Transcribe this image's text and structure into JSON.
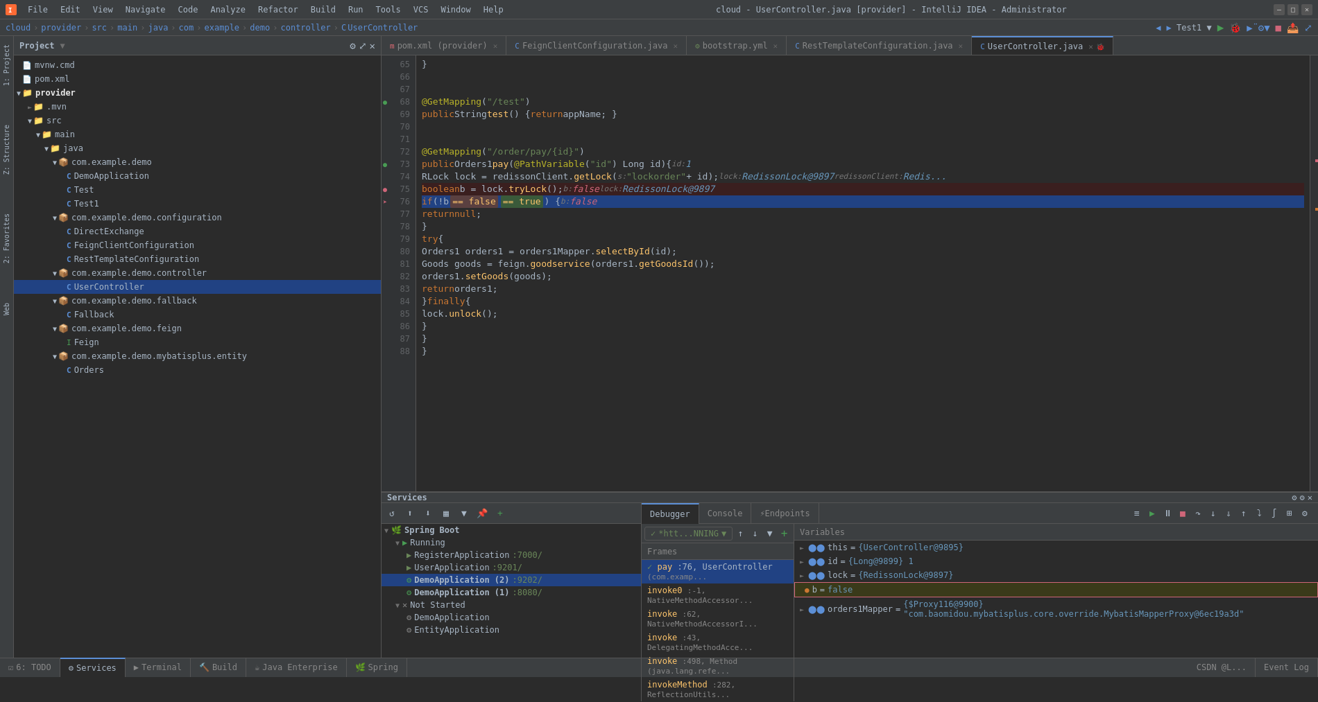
{
  "window": {
    "title": "cloud - UserController.java [provider] - IntelliJ IDEA - Administrator"
  },
  "menubar": {
    "items": [
      "File",
      "Edit",
      "View",
      "Navigate",
      "Code",
      "Analyze",
      "Refactor",
      "Build",
      "Run",
      "Tools",
      "VCS",
      "Window",
      "Help"
    ]
  },
  "breadcrumb": {
    "parts": [
      "cloud",
      "provider",
      "src",
      "main",
      "java",
      "com",
      "example",
      "demo",
      "controller",
      "UserController"
    ]
  },
  "run_config": {
    "name": "Test1"
  },
  "project_panel": {
    "title": "Project",
    "tree": [
      {
        "indent": 0,
        "type": "file",
        "icon": "mvn",
        "label": "mvnw.cmd",
        "level": 0
      },
      {
        "indent": 0,
        "type": "xml",
        "icon": "xml",
        "label": "pom.xml",
        "level": 0
      },
      {
        "indent": 0,
        "type": "folder",
        "label": "provider",
        "bold": true,
        "expanded": true,
        "level": 0
      },
      {
        "indent": 1,
        "type": "folder",
        "label": ".mvn",
        "expanded": false,
        "level": 1
      },
      {
        "indent": 1,
        "type": "folder",
        "label": "src",
        "expanded": true,
        "level": 1
      },
      {
        "indent": 2,
        "type": "folder",
        "label": "main",
        "expanded": true,
        "level": 2
      },
      {
        "indent": 3,
        "type": "folder",
        "label": "java",
        "expanded": true,
        "level": 3
      },
      {
        "indent": 4,
        "type": "folder",
        "label": "com.example.demo",
        "expanded": true,
        "level": 4
      },
      {
        "indent": 5,
        "type": "class",
        "icon": "C",
        "label": "DemoApplication",
        "level": 5
      },
      {
        "indent": 5,
        "type": "class",
        "icon": "C",
        "label": "Test",
        "level": 5
      },
      {
        "indent": 5,
        "type": "class",
        "icon": "C",
        "label": "Test1",
        "level": 5
      },
      {
        "indent": 4,
        "type": "folder",
        "label": "com.example.demo.configuration",
        "expanded": true,
        "level": 4
      },
      {
        "indent": 5,
        "type": "class",
        "icon": "C",
        "label": "DirectExchange",
        "level": 5
      },
      {
        "indent": 5,
        "type": "class",
        "icon": "C",
        "label": "FeignClientConfiguration",
        "level": 5
      },
      {
        "indent": 5,
        "type": "class",
        "icon": "C",
        "label": "RestTemplateConfiguration",
        "level": 5
      },
      {
        "indent": 4,
        "type": "folder",
        "label": "com.example.demo.controller",
        "expanded": true,
        "level": 4
      },
      {
        "indent": 5,
        "type": "class",
        "icon": "C",
        "label": "UserController",
        "selected": true,
        "level": 5
      },
      {
        "indent": 4,
        "type": "folder",
        "label": "com.example.demo.fallback",
        "expanded": true,
        "level": 4
      },
      {
        "indent": 5,
        "type": "class",
        "icon": "C",
        "label": "Fallback",
        "level": 5
      },
      {
        "indent": 4,
        "type": "folder",
        "label": "com.example.demo.feign",
        "expanded": true,
        "level": 4
      },
      {
        "indent": 5,
        "type": "interface",
        "icon": "I",
        "label": "Feign",
        "level": 5
      },
      {
        "indent": 4,
        "type": "folder",
        "label": "com.example.demo.mybatisplus.entity",
        "expanded": true,
        "level": 4
      },
      {
        "indent": 5,
        "type": "class",
        "icon": "C",
        "label": "Orders",
        "level": 5
      }
    ]
  },
  "tabs": [
    {
      "id": "pom",
      "label": "pom.xml (provider)",
      "icon": "xml",
      "active": false
    },
    {
      "id": "feign",
      "label": "FeignClientConfiguration.java",
      "icon": "C",
      "active": false
    },
    {
      "id": "bootstrap",
      "label": "bootstrap.yml",
      "icon": "yml",
      "active": false
    },
    {
      "id": "rest",
      "label": "RestTemplateConfiguration.java",
      "icon": "C",
      "active": false
    },
    {
      "id": "user",
      "label": "UserController.java",
      "icon": "C",
      "active": true
    }
  ],
  "code": {
    "lines": [
      {
        "num": 65,
        "content": "    }"
      },
      {
        "num": 66,
        "content": ""
      },
      {
        "num": 67,
        "content": ""
      },
      {
        "num": 68,
        "content": "    @GetMapping(\"/test\")",
        "type": "annotation_line",
        "gutter": "green"
      },
      {
        "num": 69,
        "content": "    public String test() { return appName; }"
      },
      {
        "num": 70,
        "content": ""
      },
      {
        "num": 71,
        "content": ""
      },
      {
        "num": 72,
        "content": "    @GetMapping(\"/order/pay/{id}\")"
      },
      {
        "num": 73,
        "content": "    public Orders1 pay(@PathVariable(\"id\") Long id){  id: 1",
        "type": "annotation_line",
        "gutter": "green"
      },
      {
        "num": 74,
        "content": "        RLock lock = redissonClient.getLock(s: \"lockorder\" + id);  lock: RedissonLock@9897  redissonClient: Redis..."
      },
      {
        "num": 75,
        "content": "        boolean b = lock.tryLock();  b: false  lock: RedissonLock@9897",
        "gutter": "breakpoint"
      },
      {
        "num": 76,
        "content": "        if(!b  == false  == true  ) {  b: false",
        "highlighted": true
      },
      {
        "num": 77,
        "content": "            return null;"
      },
      {
        "num": 78,
        "content": "        }"
      },
      {
        "num": 79,
        "content": "        try {"
      },
      {
        "num": 80,
        "content": "            Orders1 orders1 = orders1Mapper.selectById(id);"
      },
      {
        "num": 81,
        "content": "            Goods goods = feign.goodservice(orders1.getGoodsId());"
      },
      {
        "num": 82,
        "content": "            orders1.setGoods(goods);"
      },
      {
        "num": 83,
        "content": "            return orders1;"
      },
      {
        "num": 84,
        "content": "        }finally {"
      },
      {
        "num": 85,
        "content": "            lock.unlock();"
      },
      {
        "num": 86,
        "content": "        }"
      },
      {
        "num": 87,
        "content": "    }"
      },
      {
        "num": 88,
        "content": "}"
      }
    ]
  },
  "bottom_panel": {
    "title": "Services"
  },
  "debugger_tabs": [
    {
      "label": "Debugger",
      "active": true
    },
    {
      "label": "Console",
      "active": false
    },
    {
      "label": "Endpoints",
      "active": false
    }
  ],
  "thread_selector": {
    "label": "*htt...NNING"
  },
  "frames": {
    "header": "Frames",
    "items": [
      {
        "selected": true,
        "method": "pay",
        "line": 76,
        "class": "UserController",
        "extra": "(com.examp..."
      },
      {
        "method": "invoke0",
        "line": -1,
        "extra": "NativeMethodAccessor..."
      },
      {
        "method": "invoke",
        "line": 62,
        "extra": "NativeMethodAccessorI..."
      },
      {
        "method": "invoke",
        "line": 43,
        "extra": "DelegatingMethodAcce..."
      },
      {
        "method": "invoke",
        "line": 498,
        "extra": "Method (java.lang.refl..."
      },
      {
        "method": "invokeMethod",
        "line": 282,
        "extra": "ReflectionUtils..."
      }
    ]
  },
  "variables": {
    "header": "Variables",
    "items": [
      {
        "icon": "►",
        "name": "this",
        "eq": "=",
        "value": "{UserController@9895}"
      },
      {
        "icon": "►",
        "name": "id",
        "eq": "=",
        "value": "{Long@9899} 1"
      },
      {
        "icon": "►",
        "name": "lock",
        "eq": "=",
        "value": "{RedissonLock@9897}"
      },
      {
        "icon": "●",
        "name": "b",
        "eq": "=",
        "value": "false",
        "highlighted": true
      },
      {
        "icon": "►",
        "name": "orders1Mapper",
        "eq": "=",
        "value": "{$Proxy116@9900} \"com.baomidou.mybatisplus.core.override.MybatisMapperProxy@6ec19a3d\""
      }
    ]
  },
  "services": {
    "label": "Services",
    "spring_boot": {
      "label": "Spring Boot",
      "running": {
        "label": "Running",
        "items": [
          {
            "name": "RegisterApplication",
            "port": ":7000/",
            "status": "running"
          },
          {
            "name": "UserApplication",
            "port": ":9201/",
            "status": "running"
          },
          {
            "name": "DemoApplication (2)",
            "port": ":9202/",
            "status": "running",
            "bold": true
          },
          {
            "name": "DemoApplication (1)",
            "port": ":8080/",
            "status": "running",
            "bold": true
          }
        ]
      },
      "not_started": {
        "label": "Not Started",
        "items": [
          {
            "name": "DemoApplication",
            "status": "stopped"
          },
          {
            "name": "EntityApplication",
            "status": "stopped"
          }
        ]
      }
    }
  },
  "bottom_tabs": [
    {
      "label": "TODO",
      "icon": "☑",
      "active": false
    },
    {
      "label": "Services",
      "icon": "⚙",
      "active": true
    },
    {
      "label": "Terminal",
      "icon": ">_",
      "active": false
    },
    {
      "label": "Build",
      "icon": "🔨",
      "active": false
    },
    {
      "label": "Java Enterprise",
      "icon": "☕",
      "active": false
    },
    {
      "label": "Spring",
      "icon": "🌿",
      "active": false
    }
  ],
  "status_bar": {
    "todo": "6: TODO",
    "services": "8: Services",
    "social": "CSDN @L...",
    "event_log": "Event Log"
  }
}
